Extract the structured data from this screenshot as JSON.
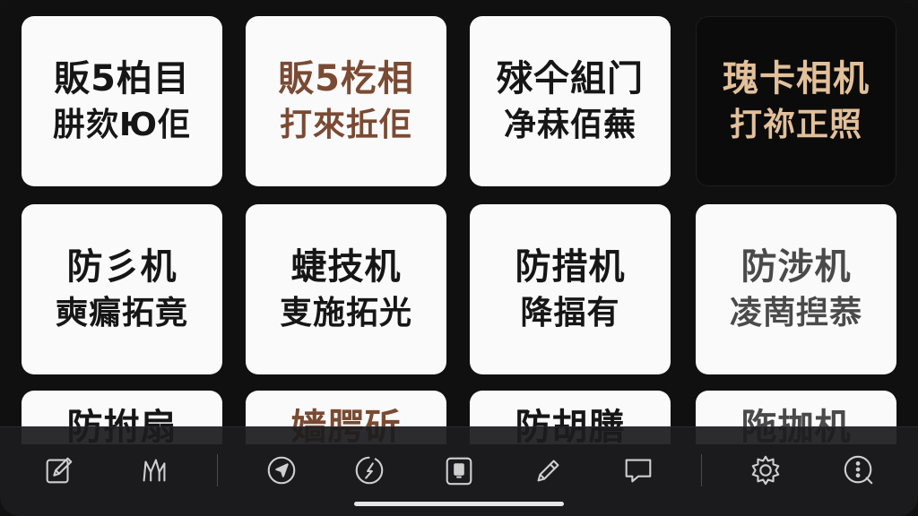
{
  "cards": [
    {
      "line1": "販5柏目",
      "line2": "肼欬Ю佢",
      "style": "white",
      "text_color": "#161616"
    },
    {
      "line1": "販5杚相",
      "line2": "打來拞佢",
      "style": "white",
      "text_color": "#7a4a33"
    },
    {
      "line1": "殏仐組门",
      "line2": "净菻佰蕪",
      "style": "white",
      "text_color": "#161616"
    },
    {
      "line1": "瑰卡相机",
      "line2": "打祢正照",
      "style": "dark",
      "text_color": "#e2c09a"
    },
    {
      "line1": "防彡机",
      "line2": "奭瘺拓竟",
      "style": "white",
      "text_color": "#161616"
    },
    {
      "line1": "蜨技机",
      "line2": "叓施拓光",
      "style": "white",
      "text_color": "#161616"
    },
    {
      "line1": "防措机",
      "line2": "降揊有",
      "style": "white",
      "text_color": "#161616"
    },
    {
      "line1": "防涉机",
      "line2": "凌菵揑菾",
      "style": "white",
      "text_color": "#4a4a4a"
    }
  ],
  "partial_cards": [
    {
      "line1": "防拊扇",
      "text_color": "#161616"
    },
    {
      "line1": "嫱腭斫",
      "text_color": "#7a4a33"
    },
    {
      "line1": "防胡膳",
      "text_color": "#161616"
    },
    {
      "line1": "陁拁机",
      "text_color": "#4a4a4a"
    }
  ],
  "toolbar": {
    "icons": [
      "edit-icon",
      "map-icon",
      "navigation-icon",
      "compass-icon",
      "clipboard-icon",
      "pen-icon",
      "chat-icon",
      "settings-icon",
      "more-info-icon"
    ]
  }
}
